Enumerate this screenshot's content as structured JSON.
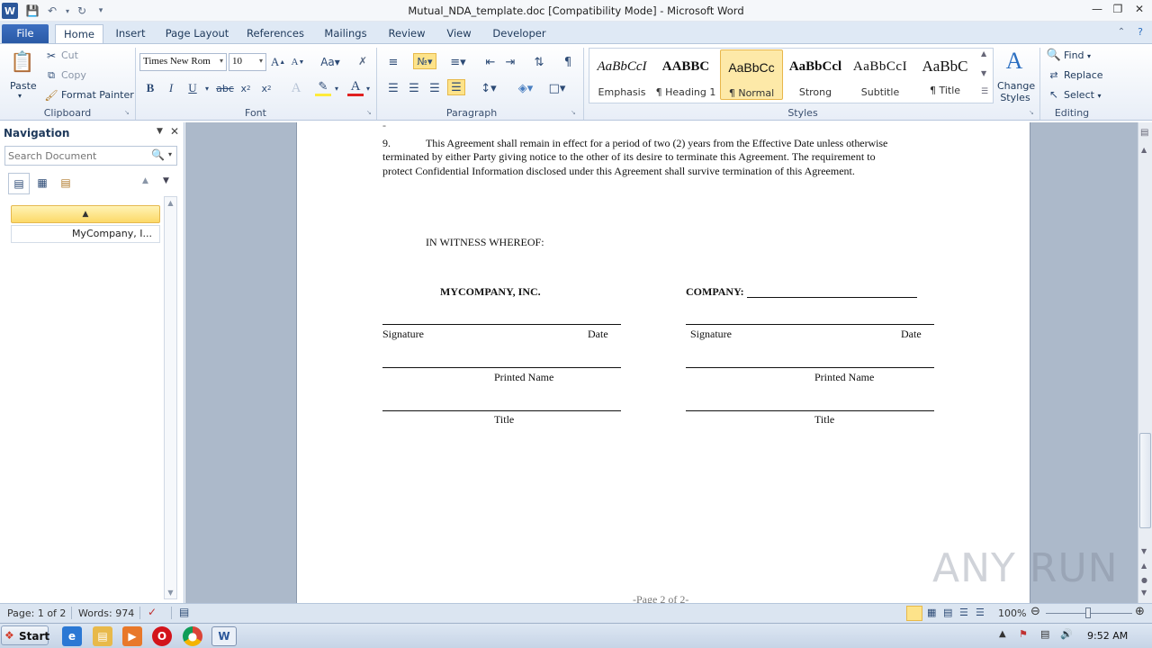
{
  "window": {
    "title": "Mutual_NDA_template.doc [Compatibility Mode] - Microsoft Word"
  },
  "tabs": [
    "File",
    "Home",
    "Insert",
    "Page Layout",
    "References",
    "Mailings",
    "Review",
    "View",
    "Developer"
  ],
  "clipboard": {
    "paste": "Paste",
    "cut": "Cut",
    "copy": "Copy",
    "format_painter": "Format Painter",
    "label": "Clipboard"
  },
  "font": {
    "family": "Times New Rom",
    "size": "10",
    "label": "Font"
  },
  "paragraph": {
    "label": "Paragraph"
  },
  "styles": {
    "items": [
      {
        "preview": "AaBbCcI",
        "name": "Emphasis"
      },
      {
        "preview": "AABBC",
        "name": "¶ Heading 1"
      },
      {
        "preview": "AaBbCc",
        "name": "¶ Normal"
      },
      {
        "preview": "AaBbCcl",
        "name": "Strong"
      },
      {
        "preview": "AaBbCcI",
        "name": "Subtitle"
      },
      {
        "preview": "AaBbC",
        "name": "¶ Title"
      }
    ],
    "change": "Change Styles",
    "label": "Styles"
  },
  "editing": {
    "find": "Find",
    "replace": "Replace",
    "select": "Select",
    "label": "Editing"
  },
  "nav": {
    "title": "Navigation",
    "search_placeholder": "Search Document",
    "item": "MyCompany, I..."
  },
  "document": {
    "para9_num": "9.",
    "para9_l1": "This Agreement shall remain in effect for a period of two (2) years from the Effective Date unless otherwise",
    "para9_l2": "terminated by either Party giving notice to the other of its desire to terminate this Agreement.  The requirement to",
    "para9_l3": "protect Confidential Information disclosed under this Agreement shall survive termination of this Agreement.",
    "witness": "IN WITNESS  WHEREOF:",
    "left_company": "MYCOMPANY,  INC.",
    "right_company": "COMPANY:",
    "signature": "Signature",
    "date": "Date",
    "printed_name": "Printed Name",
    "title": "Title",
    "footer": "-Page 2 of 2-"
  },
  "status": {
    "page": "Page: 1 of 2",
    "words": "Words: 974",
    "zoom": "100%"
  },
  "taskbar": {
    "start": "Start",
    "time": "9:52 AM"
  },
  "watermark": "ANY RUN"
}
